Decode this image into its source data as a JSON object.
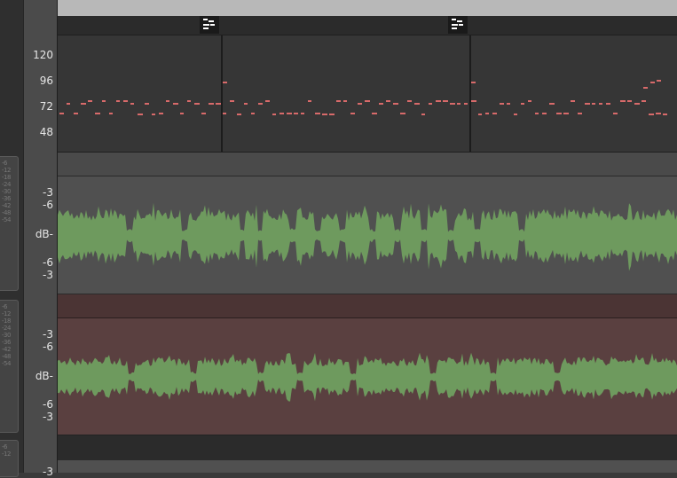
{
  "ruler": {
    "midi_labels": [
      "120",
      "96",
      "72",
      "48"
    ],
    "audio1_labels": [
      "-3",
      "-6",
      "dB-",
      "-6",
      "-3"
    ],
    "audio2_labels": [
      "-3",
      "-6",
      "dB-",
      "-6",
      "-3"
    ],
    "bottom_label": "-3"
  },
  "meters": {
    "track1_ticks": [
      "-6",
      "-12",
      "-18",
      "-24",
      "-30",
      "-36",
      "-42",
      "-48",
      "-54"
    ],
    "track2_ticks": [
      "-6",
      "-12",
      "-18",
      "-24",
      "-30",
      "-36",
      "-42",
      "-48",
      "-54"
    ],
    "track3_ticks": [
      "-6",
      "-12"
    ]
  },
  "colors": {
    "waveform": "#6e9a5e",
    "midi_note": "#d86a6a",
    "midi_lane_bg": "#363636",
    "audio_track1_bg": "#505050",
    "audio_track2_bg": "#5a4040"
  },
  "icons": {
    "tempo_marker": "tempo-marker-icon"
  }
}
